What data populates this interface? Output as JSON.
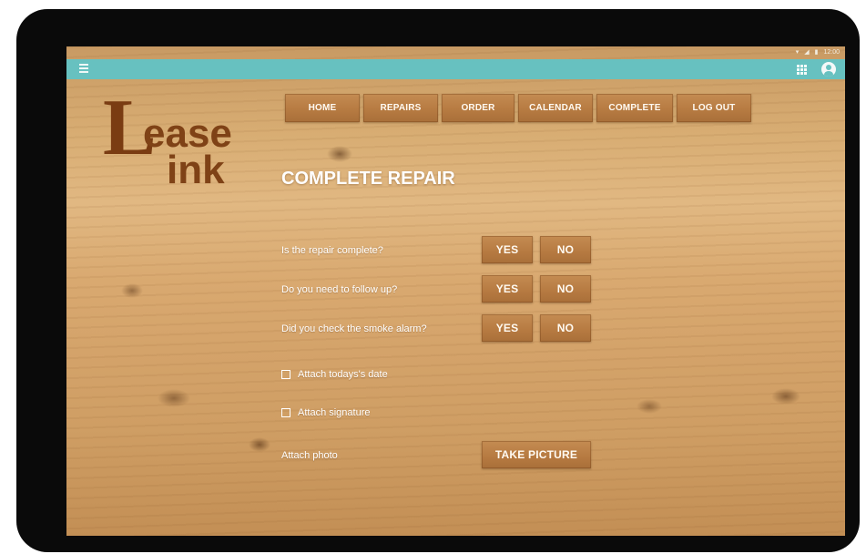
{
  "status_bar": {
    "time": "12:00"
  },
  "logo": {
    "letter_l": "L",
    "line1": "ease",
    "line2": "ink"
  },
  "nav": {
    "home": "HOME",
    "repairs": "REPAIRS",
    "order": "ORDER",
    "calendar": "CALENDAR",
    "complete": "COMPLETE",
    "logout": "LOG OUT"
  },
  "page": {
    "title": "COMPLETE REPAIR"
  },
  "questions": [
    {
      "label": "Is the repair complete?",
      "yes": "YES",
      "no": "NO"
    },
    {
      "label": "Do you need to follow up?",
      "yes": "YES",
      "no": "NO"
    },
    {
      "label": "Did you check the smoke alarm?",
      "yes": "YES",
      "no": "NO"
    }
  ],
  "checkboxes": [
    {
      "label": "Attach todays's date",
      "checked": false
    },
    {
      "label": "Attach signature",
      "checked": false
    }
  ],
  "photo": {
    "label": "Attach photo",
    "button": "TAKE PICTURE"
  },
  "colors": {
    "app_bar": "#67c1c0",
    "button": "#b77b42",
    "logo": "#7f4216"
  },
  "icons": {
    "menu": "menu-icon",
    "apps": "apps-grid-icon",
    "account": "account-circle-icon"
  }
}
